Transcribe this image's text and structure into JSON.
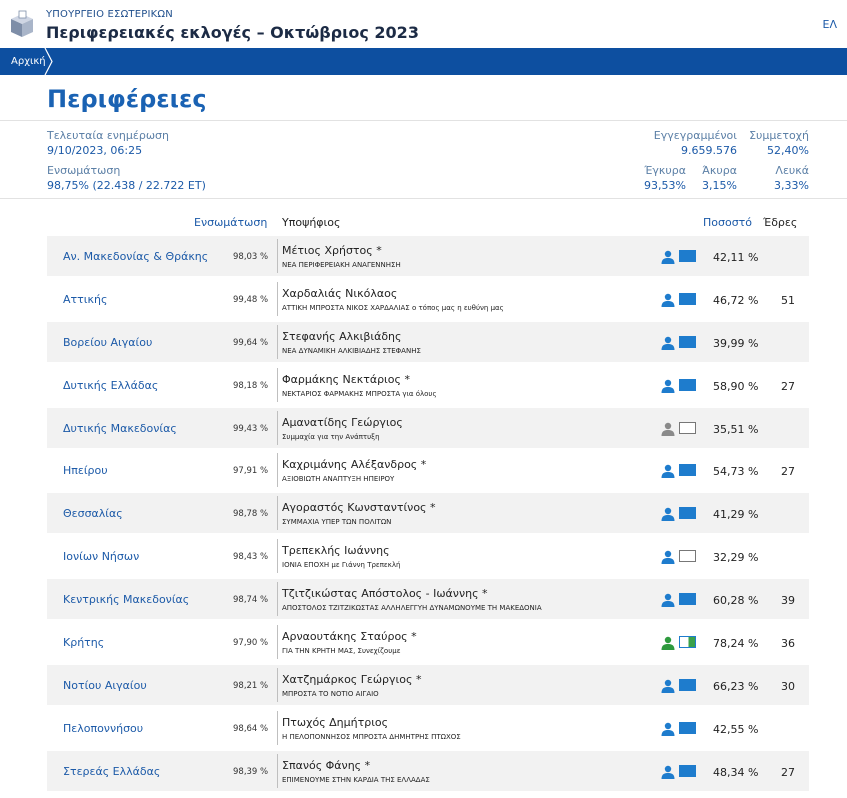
{
  "header": {
    "ministry": "ΥΠΟΥΡΓΕΙΟ ΕΣΩΤΕΡΙΚΩΝ",
    "title": "Περιφερειακές εκλογές – Οκτώβριος 2023",
    "lang": "ΕΛ"
  },
  "nav": {
    "home": "Αρχική"
  },
  "page": {
    "title": "Περιφέρειες"
  },
  "info": {
    "last_update_label": "Τελευταία ενημέρωση",
    "last_update_value": "9/10/2023, 06:25",
    "integration_label": "Ενσωμάτωση",
    "integration_value": "98,75% (22.438 / 22.722 ΕΤ)",
    "registered_label": "Εγγεγραμμένοι",
    "registered_value": "9.659.576",
    "turnout_label": "Συμμετοχή",
    "turnout_value": "52,40%",
    "valid_label": "Έγκυρα",
    "valid_value": "93,53%",
    "invalid_label": "Άκυρα",
    "invalid_value": "3,15%",
    "blank_label": "Λευκά",
    "blank_value": "3,33%"
  },
  "table": {
    "headers": {
      "integration": "Ενσωμάτωση",
      "candidate": "Υποψήφιος",
      "share": "Ποσοστό",
      "seats": "Έδρες"
    },
    "rows": [
      {
        "region": "Αν. Μακεδονίας & Θράκης",
        "integration": "98,03 %",
        "candidate": "Μέτιος Χρήστος *",
        "party": "ΝΕΑ ΠΕΡΙΦΕΡΕΙΑΚΗ ΑΝΑΓΕΝΝΗΣΗ",
        "share": "42,11 %",
        "seats": "",
        "person_color": "#1e7ccd",
        "flag": "full"
      },
      {
        "region": "Αττικής",
        "integration": "99,48 %",
        "candidate": "Χαρδαλιάς Νικόλαος",
        "party": "ΑΤΤΙΚΗ ΜΠΡΟΣΤΑ ΝΙΚΟΣ ΧΑΡΔΑΛΙΑΣ ο τόπος μας η ευθύνη μας",
        "share": "46,72 %",
        "seats": "51",
        "person_color": "#1e7ccd",
        "flag": "full"
      },
      {
        "region": "Βορείου Αιγαίου",
        "integration": "99,64 %",
        "candidate": "Στεφανής Αλκιβιάδης",
        "party": "ΝΕΑ ΔΥΝΑΜΙΚΗ ΑΛΚΙΒΙΑΔΗΣ ΣΤΕΦΑΝΗΣ",
        "share": "39,99 %",
        "seats": "",
        "person_color": "#1e7ccd",
        "flag": "full"
      },
      {
        "region": "Δυτικής Ελλάδας",
        "integration": "98,18 %",
        "candidate": "Φαρμάκης Νεκτάριος *",
        "party": "ΝΕΚΤΑΡΙΟΣ ΦΑΡΜΑΚΗΣ ΜΠΡΟΣΤΑ για όλους",
        "share": "58,90 %",
        "seats": "27",
        "person_color": "#1e7ccd",
        "flag": "full"
      },
      {
        "region": "Δυτικής Μακεδονίας",
        "integration": "99,43 %",
        "candidate": "Αμανατίδης Γεώργιος",
        "party": "Συμμαχία για την Ανάπτυξη",
        "share": "35,51 %",
        "seats": "",
        "person_color": "#8a8a8a",
        "flag": "empty"
      },
      {
        "region": "Ηπείρου",
        "integration": "97,91 %",
        "candidate": "Καχριμάνης Αλέξανδρος *",
        "party": "ΑΞΙΟΒΙΩΤΗ ΑΝΑΠΤΥΞΗ ΗΠΕΙΡΟΥ",
        "share": "54,73 %",
        "seats": "27",
        "person_color": "#1e7ccd",
        "flag": "full"
      },
      {
        "region": "Θεσσαλίας",
        "integration": "98,78 %",
        "candidate": "Αγοραστός Κωνσταντίνος *",
        "party": "ΣΥΜΜΑΧΙΑ ΥΠΕΡ ΤΩΝ ΠΟΛΙΤΩΝ",
        "share": "41,29 %",
        "seats": "",
        "person_color": "#1e7ccd",
        "flag": "full"
      },
      {
        "region": "Ιονίων Νήσων",
        "integration": "98,43 %",
        "candidate": "Τρεπεκλής Ιωάννης",
        "party": "ΙΟΝΙΑ ΕΠΟΧΗ με Γιάννη Τρεπεκλή",
        "share": "32,29 %",
        "seats": "",
        "person_color": "#1e7ccd",
        "flag": "empty"
      },
      {
        "region": "Κεντρικής Μακεδονίας",
        "integration": "98,74 %",
        "candidate": "Τζιτζικώστας Απόστολος - Ιωάννης *",
        "party": "ΑΠΟΣΤΟΛΟΣ ΤΖΙΤΖΙΚΩΣΤΑΣ ΑΛΛΗΛΕΓΓΥΗ ΔΥΝΑΜΩΝΟΥΜΕ ΤΗ ΜΑΚΕΔΟΝΙΑ",
        "share": "60,28 %",
        "seats": "39",
        "person_color": "#1e7ccd",
        "flag": "full"
      },
      {
        "region": "Κρήτης",
        "integration": "97,90 %",
        "candidate": "Αρναουτάκης Σταύρος *",
        "party": "ΓΙΑ ΤΗΝ ΚΡΗΤΗ ΜΑΣ, Συνεχίζουμε",
        "share": "78,24 %",
        "seats": "36",
        "person_color": "#2e9a3e",
        "flag": "split"
      },
      {
        "region": "Νοτίου Αιγαίου",
        "integration": "98,21 %",
        "candidate": "Χατζημάρκος Γεώργιος *",
        "party": "ΜΠΡΟΣΤΑ ΤΟ ΝΟΤΙΟ ΑΙΓΑΙΟ",
        "share": "66,23 %",
        "seats": "30",
        "person_color": "#1e7ccd",
        "flag": "full"
      },
      {
        "region": "Πελοποννήσου",
        "integration": "98,64 %",
        "candidate": "Πτωχός Δημήτριος",
        "party": "Η ΠΕΛΟΠΟΝΝΗΣΟΣ ΜΠΡΟΣΤΑ ΔΗΜΗΤΡΗΣ ΠΤΩΧΟΣ",
        "share": "42,55 %",
        "seats": "",
        "person_color": "#1e7ccd",
        "flag": "full"
      },
      {
        "region": "Στερεάς Ελλάδας",
        "integration": "98,39 %",
        "candidate": "Σπανός Φάνης *",
        "party": "ΕΠΙΜΕΝΟΥΜΕ ΣΤΗΝ ΚΑΡΔΙΑ ΤΗΣ ΕΛΛΑΔΑΣ",
        "share": "48,34 %",
        "seats": "27",
        "person_color": "#1e7ccd",
        "flag": "full"
      }
    ]
  }
}
